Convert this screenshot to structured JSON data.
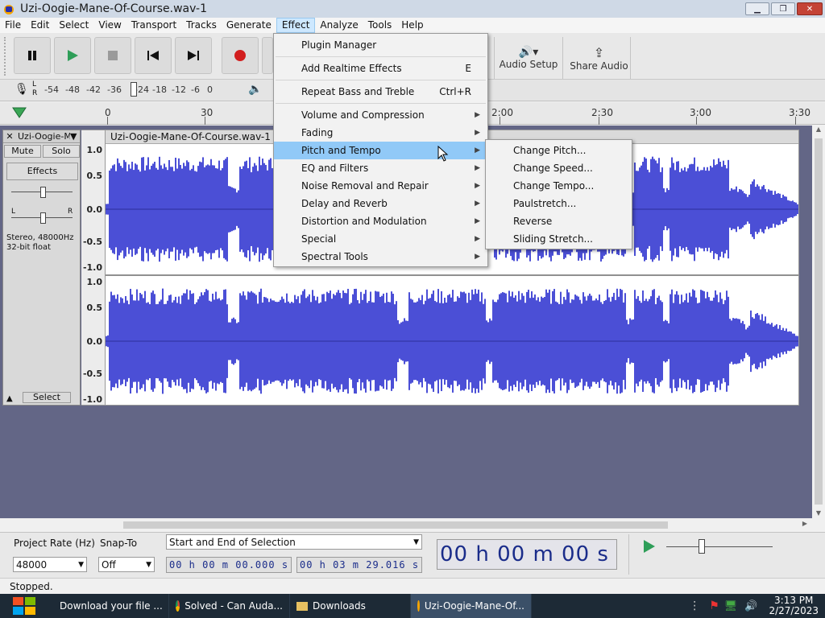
{
  "window": {
    "title": "Uzi-Oogie-Mane-Of-Course.wav-1"
  },
  "menubar": [
    "File",
    "Edit",
    "Select",
    "View",
    "Transport",
    "Tracks",
    "Generate",
    "Effect",
    "Analyze",
    "Tools",
    "Help"
  ],
  "toolbar": {
    "audio_setup": "Audio Setup",
    "share_audio": "Share Audio"
  },
  "meter": {
    "ticks": [
      "-54",
      "-48",
      "-42",
      "-36",
      "-24",
      "-18",
      "-12",
      "-6",
      "0"
    ],
    "left": "L",
    "right": "R"
  },
  "timeline": {
    "labels": [
      "0",
      "30",
      "2:00",
      "2:30",
      "3:00",
      "3:30"
    ]
  },
  "track": {
    "name": "Uzi-Oogie-M",
    "clip_title": "Uzi-Oogie-Mane-Of-Course.wav-1",
    "mute": "Mute",
    "solo": "Solo",
    "effects": "Effects",
    "info_line1": "Stereo, 48000Hz",
    "info_line2": "32-bit float",
    "select": "Select",
    "gain_l": "L",
    "gain_r": "R",
    "scale_top": [
      "1.0",
      "0.5",
      "0.0",
      "-0.5",
      "-1.0"
    ],
    "scale_bottom": [
      "1.0",
      "0.5",
      "0.0",
      "-0.5",
      "-1.0"
    ],
    "wave_color": "#4b4fd6"
  },
  "effect_menu": [
    {
      "label": "Plugin Manager"
    },
    {
      "label": "Add Realtime Effects",
      "shortcut": "E"
    },
    {
      "label": "Repeat Bass and Treble",
      "shortcut": "Ctrl+R"
    },
    {
      "label": "Volume and Compression",
      "submenu": true
    },
    {
      "label": "Fading",
      "submenu": true
    },
    {
      "label": "Pitch and Tempo",
      "submenu": true,
      "highlighted": true
    },
    {
      "label": "EQ and Filters",
      "submenu": true
    },
    {
      "label": "Noise Removal and Repair",
      "submenu": true
    },
    {
      "label": "Delay and Reverb",
      "submenu": true
    },
    {
      "label": "Distortion and Modulation",
      "submenu": true
    },
    {
      "label": "Special",
      "submenu": true
    },
    {
      "label": "Spectral Tools",
      "submenu": true
    }
  ],
  "pitch_submenu": [
    "Change Pitch...",
    "Change Speed...",
    "Change Tempo...",
    "Paulstretch...",
    "Reverse",
    "Sliding Stretch..."
  ],
  "bottom": {
    "project_rate_label": "Project Rate (Hz)",
    "project_rate": "48000",
    "snap_label": "Snap-To",
    "snap": "Off",
    "selection_mode": "Start and End of Selection",
    "sel_start": "00 h 00 m 00.000 s",
    "sel_end": "00 h 03 m 29.016 s",
    "big_time": "00 h 00 m 00 s"
  },
  "status": "Stopped.",
  "taskbar": [
    {
      "label": "Download your file ...",
      "icon": "downloader-icon"
    },
    {
      "label": "Solved - Can Auda...",
      "icon": "chrome-icon"
    },
    {
      "label": "Downloads",
      "icon": "folder-icon"
    },
    {
      "label": "Uzi-Oogie-Mane-Of...",
      "icon": "audacity-icon",
      "active": true
    }
  ],
  "clock": {
    "time": "3:13 PM",
    "date": "2/27/2023"
  }
}
